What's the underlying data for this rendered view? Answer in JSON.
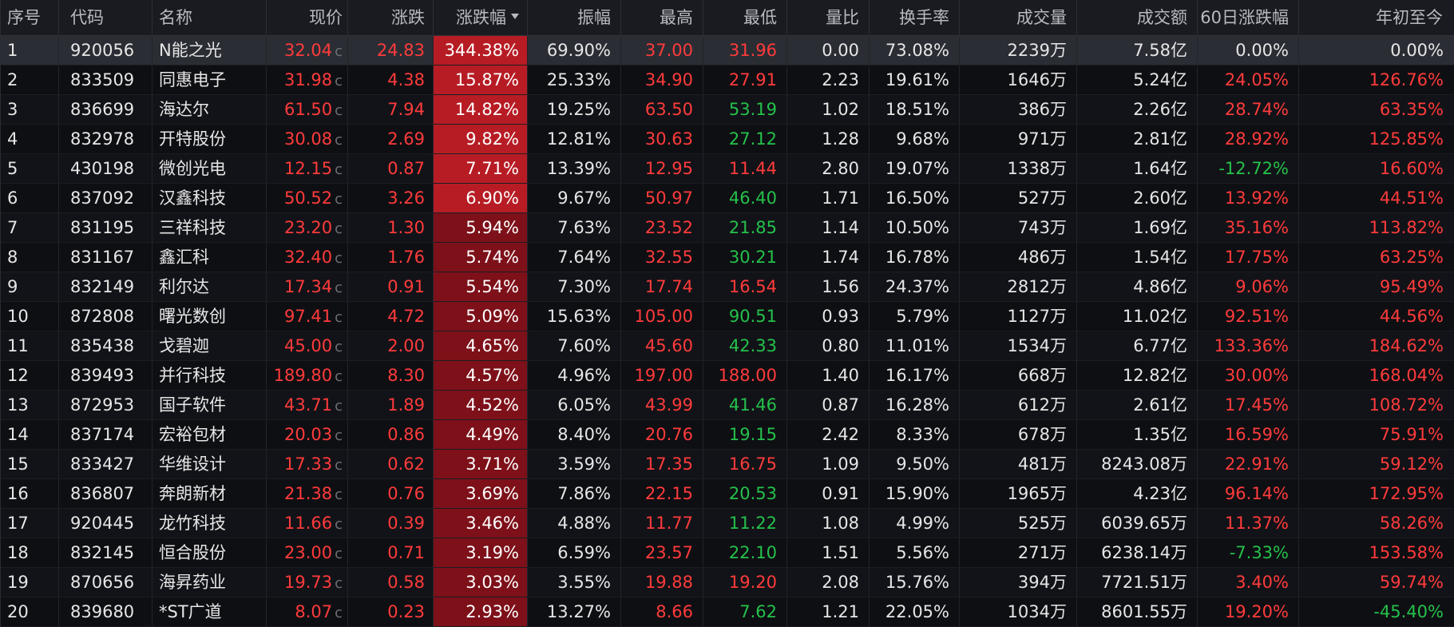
{
  "colors": {
    "up": "#ff3b3b",
    "down": "#25c14b",
    "flat": "#e6e6e6",
    "pct_bg_strong": "#b71c24",
    "pct_bg_weak": "#7d1019"
  },
  "header": {
    "idx": "序号",
    "code": "代码",
    "name": "名称",
    "price": "现价",
    "chg": "涨跌",
    "pct": "涨跌幅",
    "amp": "振幅",
    "high": "最高",
    "low": "最低",
    "vr": "量比",
    "turn": "换手率",
    "vol": "成交量",
    "amt": "成交额",
    "d60": "60日涨跌幅",
    "ytd": "年初至今"
  },
  "sort_icon": "sort-desc-icon",
  "price_flag": "c",
  "rows": [
    {
      "idx": "1",
      "code": "920056",
      "name": "N能之光",
      "price": "32.04",
      "chg": "24.83",
      "pct": "344.38%",
      "pct_level": 1.0,
      "amp": "69.90%",
      "high": "37.00",
      "high_dir": "up",
      "low": "31.96",
      "low_dir": "up",
      "vr": "0.00",
      "turn": "73.08%",
      "vol": "2239万",
      "amt": "7.58亿",
      "d60": "0.00%",
      "d60_dir": "flat",
      "ytd": "0.00%",
      "ytd_dir": "flat"
    },
    {
      "idx": "2",
      "code": "833509",
      "name": "同惠电子",
      "price": "31.98",
      "chg": "4.38",
      "pct": "15.87%",
      "pct_level": 1.0,
      "amp": "25.33%",
      "high": "34.90",
      "high_dir": "up",
      "low": "27.91",
      "low_dir": "up",
      "vr": "2.23",
      "turn": "19.61%",
      "vol": "1646万",
      "amt": "5.24亿",
      "d60": "24.05%",
      "d60_dir": "up",
      "ytd": "126.76%",
      "ytd_dir": "up"
    },
    {
      "idx": "3",
      "code": "836699",
      "name": "海达尔",
      "price": "61.50",
      "chg": "7.94",
      "pct": "14.82%",
      "pct_level": 1.0,
      "amp": "19.25%",
      "high": "63.50",
      "high_dir": "up",
      "low": "53.19",
      "low_dir": "down",
      "vr": "1.02",
      "turn": "18.51%",
      "vol": "386万",
      "amt": "2.26亿",
      "d60": "28.74%",
      "d60_dir": "up",
      "ytd": "63.35%",
      "ytd_dir": "up"
    },
    {
      "idx": "4",
      "code": "832978",
      "name": "开特股份",
      "price": "30.08",
      "chg": "2.69",
      "pct": "9.82%",
      "pct_level": 1.0,
      "amp": "12.81%",
      "high": "30.63",
      "high_dir": "up",
      "low": "27.12",
      "low_dir": "down",
      "vr": "1.28",
      "turn": "9.68%",
      "vol": "971万",
      "amt": "2.81亿",
      "d60": "28.92%",
      "d60_dir": "up",
      "ytd": "125.85%",
      "ytd_dir": "up"
    },
    {
      "idx": "5",
      "code": "430198",
      "name": "微创光电",
      "price": "12.15",
      "chg": "0.87",
      "pct": "7.71%",
      "pct_level": 1.0,
      "amp": "13.39%",
      "high": "12.95",
      "high_dir": "up",
      "low": "11.44",
      "low_dir": "up",
      "vr": "2.80",
      "turn": "19.07%",
      "vol": "1338万",
      "amt": "1.64亿",
      "d60": "-12.72%",
      "d60_dir": "down",
      "ytd": "16.60%",
      "ytd_dir": "up"
    },
    {
      "idx": "6",
      "code": "837092",
      "name": "汉鑫科技",
      "price": "50.52",
      "chg": "3.26",
      "pct": "6.90%",
      "pct_level": 1.0,
      "amp": "9.67%",
      "high": "50.97",
      "high_dir": "up",
      "low": "46.40",
      "low_dir": "down",
      "vr": "1.71",
      "turn": "16.50%",
      "vol": "527万",
      "amt": "2.60亿",
      "d60": "13.92%",
      "d60_dir": "up",
      "ytd": "44.51%",
      "ytd_dir": "up"
    },
    {
      "idx": "7",
      "code": "831195",
      "name": "三祥科技",
      "price": "23.20",
      "chg": "1.30",
      "pct": "5.94%",
      "pct_level": 0.5,
      "amp": "7.63%",
      "high": "23.52",
      "high_dir": "up",
      "low": "21.85",
      "low_dir": "down",
      "vr": "1.14",
      "turn": "10.50%",
      "vol": "743万",
      "amt": "1.69亿",
      "d60": "35.16%",
      "d60_dir": "up",
      "ytd": "113.82%",
      "ytd_dir": "up"
    },
    {
      "idx": "8",
      "code": "831167",
      "name": "鑫汇科",
      "price": "32.40",
      "chg": "1.76",
      "pct": "5.74%",
      "pct_level": 0.5,
      "amp": "7.64%",
      "high": "32.55",
      "high_dir": "up",
      "low": "30.21",
      "low_dir": "down",
      "vr": "1.74",
      "turn": "16.78%",
      "vol": "486万",
      "amt": "1.54亿",
      "d60": "17.75%",
      "d60_dir": "up",
      "ytd": "63.25%",
      "ytd_dir": "up"
    },
    {
      "idx": "9",
      "code": "832149",
      "name": "利尔达",
      "price": "17.34",
      "chg": "0.91",
      "pct": "5.54%",
      "pct_level": 0.5,
      "amp": "7.30%",
      "high": "17.74",
      "high_dir": "up",
      "low": "16.54",
      "low_dir": "up",
      "vr": "1.56",
      "turn": "24.37%",
      "vol": "2812万",
      "amt": "4.86亿",
      "d60": "9.06%",
      "d60_dir": "up",
      "ytd": "95.49%",
      "ytd_dir": "up"
    },
    {
      "idx": "10",
      "code": "872808",
      "name": "曙光数创",
      "price": "97.41",
      "chg": "4.72",
      "pct": "5.09%",
      "pct_level": 0.5,
      "amp": "15.63%",
      "high": "105.00",
      "high_dir": "up",
      "low": "90.51",
      "low_dir": "down",
      "vr": "0.93",
      "turn": "5.79%",
      "vol": "1127万",
      "amt": "11.02亿",
      "d60": "92.51%",
      "d60_dir": "up",
      "ytd": "44.56%",
      "ytd_dir": "up"
    },
    {
      "idx": "11",
      "code": "835438",
      "name": "戈碧迦",
      "price": "45.00",
      "chg": "2.00",
      "pct": "4.65%",
      "pct_level": 0.5,
      "amp": "7.60%",
      "high": "45.60",
      "high_dir": "up",
      "low": "42.33",
      "low_dir": "down",
      "vr": "0.80",
      "turn": "11.01%",
      "vol": "1534万",
      "amt": "6.77亿",
      "d60": "133.36%",
      "d60_dir": "up",
      "ytd": "184.62%",
      "ytd_dir": "up"
    },
    {
      "idx": "12",
      "code": "839493",
      "name": "并行科技",
      "price": "189.80",
      "chg": "8.30",
      "pct": "4.57%",
      "pct_level": 0.5,
      "amp": "4.96%",
      "high": "197.00",
      "high_dir": "up",
      "low": "188.00",
      "low_dir": "up",
      "vr": "1.40",
      "turn": "16.17%",
      "vol": "668万",
      "amt": "12.82亿",
      "d60": "30.00%",
      "d60_dir": "up",
      "ytd": "168.04%",
      "ytd_dir": "up"
    },
    {
      "idx": "13",
      "code": "872953",
      "name": "国子软件",
      "price": "43.71",
      "chg": "1.89",
      "pct": "4.52%",
      "pct_level": 0.5,
      "amp": "6.05%",
      "high": "43.99",
      "high_dir": "up",
      "low": "41.46",
      "low_dir": "down",
      "vr": "0.87",
      "turn": "16.28%",
      "vol": "612万",
      "amt": "2.61亿",
      "d60": "17.45%",
      "d60_dir": "up",
      "ytd": "108.72%",
      "ytd_dir": "up"
    },
    {
      "idx": "14",
      "code": "837174",
      "name": "宏裕包材",
      "price": "20.03",
      "chg": "0.86",
      "pct": "4.49%",
      "pct_level": 0.5,
      "amp": "8.40%",
      "high": "20.76",
      "high_dir": "up",
      "low": "19.15",
      "low_dir": "down",
      "vr": "2.42",
      "turn": "8.33%",
      "vol": "678万",
      "amt": "1.35亿",
      "d60": "16.59%",
      "d60_dir": "up",
      "ytd": "75.91%",
      "ytd_dir": "up"
    },
    {
      "idx": "15",
      "code": "833427",
      "name": "华维设计",
      "price": "17.33",
      "chg": "0.62",
      "pct": "3.71%",
      "pct_level": 0.5,
      "amp": "3.59%",
      "high": "17.35",
      "high_dir": "up",
      "low": "16.75",
      "low_dir": "up",
      "vr": "1.09",
      "turn": "9.50%",
      "vol": "481万",
      "amt": "8243.08万",
      "d60": "22.91%",
      "d60_dir": "up",
      "ytd": "59.12%",
      "ytd_dir": "up"
    },
    {
      "idx": "16",
      "code": "836807",
      "name": "奔朗新材",
      "price": "21.38",
      "chg": "0.76",
      "pct": "3.69%",
      "pct_level": 0.5,
      "amp": "7.86%",
      "high": "22.15",
      "high_dir": "up",
      "low": "20.53",
      "low_dir": "down",
      "vr": "0.91",
      "turn": "15.90%",
      "vol": "1965万",
      "amt": "4.23亿",
      "d60": "96.14%",
      "d60_dir": "up",
      "ytd": "172.95%",
      "ytd_dir": "up"
    },
    {
      "idx": "17",
      "code": "920445",
      "name": "龙竹科技",
      "price": "11.66",
      "chg": "0.39",
      "pct": "3.46%",
      "pct_level": 0.5,
      "amp": "4.88%",
      "high": "11.77",
      "high_dir": "up",
      "low": "11.22",
      "low_dir": "down",
      "vr": "1.08",
      "turn": "4.99%",
      "vol": "525万",
      "amt": "6039.65万",
      "d60": "11.37%",
      "d60_dir": "up",
      "ytd": "58.26%",
      "ytd_dir": "up"
    },
    {
      "idx": "18",
      "code": "832145",
      "name": "恒合股份",
      "price": "23.00",
      "chg": "0.71",
      "pct": "3.19%",
      "pct_level": 0.5,
      "amp": "6.59%",
      "high": "23.57",
      "high_dir": "up",
      "low": "22.10",
      "low_dir": "down",
      "vr": "1.51",
      "turn": "5.56%",
      "vol": "271万",
      "amt": "6238.14万",
      "d60": "-7.33%",
      "d60_dir": "down",
      "ytd": "153.58%",
      "ytd_dir": "up"
    },
    {
      "idx": "19",
      "code": "870656",
      "name": "海昇药业",
      "price": "19.73",
      "chg": "0.58",
      "pct": "3.03%",
      "pct_level": 0.5,
      "amp": "3.55%",
      "high": "19.88",
      "high_dir": "up",
      "low": "19.20",
      "low_dir": "up",
      "vr": "2.08",
      "turn": "15.76%",
      "vol": "394万",
      "amt": "7721.51万",
      "d60": "3.40%",
      "d60_dir": "up",
      "ytd": "59.74%",
      "ytd_dir": "up"
    },
    {
      "idx": "20",
      "code": "839680",
      "name": "*ST广道",
      "price": "8.07",
      "chg": "0.23",
      "pct": "2.93%",
      "pct_level": 0.5,
      "amp": "13.27%",
      "high": "8.66",
      "high_dir": "up",
      "low": "7.62",
      "low_dir": "down",
      "vr": "1.21",
      "turn": "22.05%",
      "vol": "1034万",
      "amt": "8601.55万",
      "d60": "19.20%",
      "d60_dir": "up",
      "ytd": "-45.40%",
      "ytd_dir": "down"
    }
  ]
}
